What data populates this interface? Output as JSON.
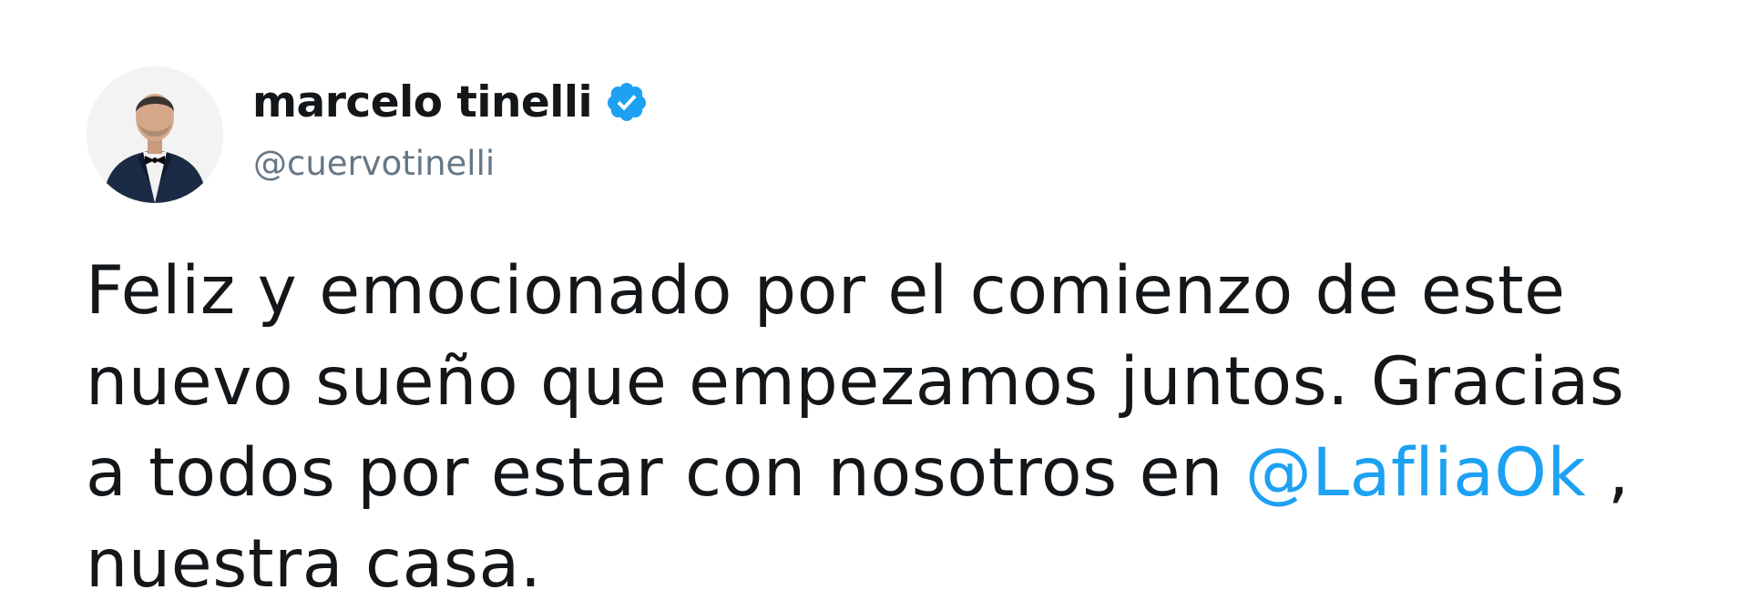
{
  "tweet": {
    "author": {
      "display_name": "marcelo tinelli",
      "handle": "@cuervotinelli",
      "verified": true,
      "avatar_icon": "profile-photo-man-in-tuxedo"
    },
    "text": {
      "line1": "Feliz y emocionado por el comienzo de este",
      "line2": "nuevo sueño que empezamos juntos. Gracias",
      "line3_before": "a todos por estar con nosotros en ",
      "mention": "@LafliaOk",
      "line3_after": " ,",
      "line4": "nuestra casa."
    }
  },
  "colors": {
    "text": "#14171a",
    "secondary": "#657786",
    "link": "#1da1f2",
    "verified_badge": "#1da1f2"
  }
}
